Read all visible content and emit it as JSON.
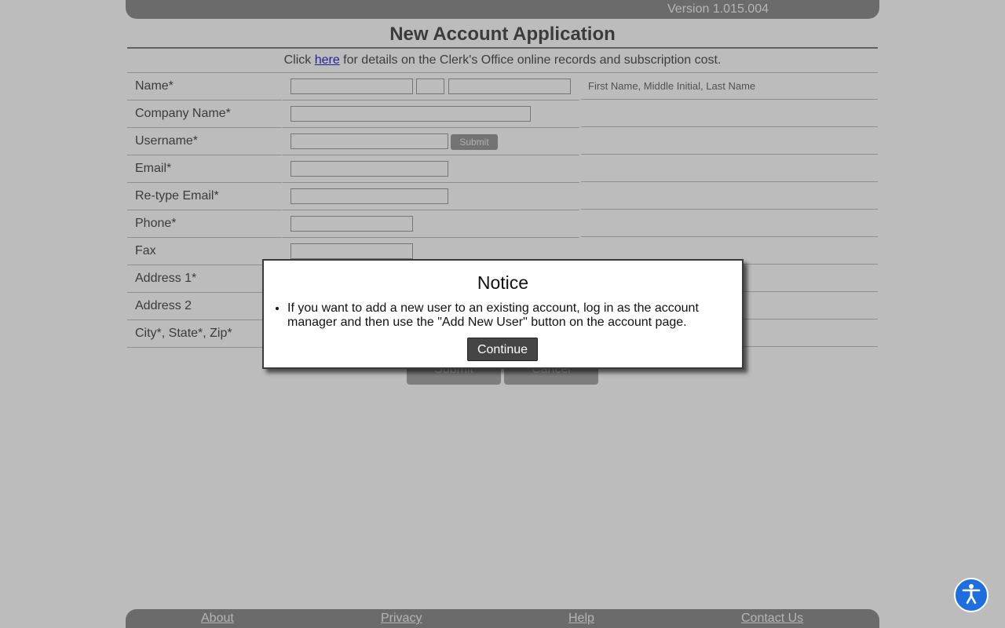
{
  "header": {
    "version": "Version 1.015.004"
  },
  "page": {
    "title": "New Account Application",
    "info": {
      "prefix": "Click ",
      "link": "here",
      "suffix": " for details on the Clerk's Office online records and subscription cost."
    }
  },
  "form": {
    "rows": [
      {
        "label": "Name*",
        "hint": "First Name, Middle Initial, Last Name"
      },
      {
        "label": "Company Name*"
      },
      {
        "label": "Username*",
        "submit_label": "Submit"
      },
      {
        "label": "Email*"
      },
      {
        "label": "Re-type Email*"
      },
      {
        "label": "Phone*"
      },
      {
        "label": "Fax"
      },
      {
        "label": "Address 1*"
      },
      {
        "label": "Address 2"
      },
      {
        "label": "City*, State*, Zip*"
      }
    ],
    "buttons": {
      "submit": "Submit",
      "cancel": "Cancel"
    }
  },
  "footer": {
    "links": [
      "About",
      "Privacy",
      "Help",
      "Contact Us"
    ]
  },
  "modal": {
    "title": "Notice",
    "items": [
      "If you want to add a new user to an existing account, log in as the account manager and then use the \"Add New User\" button on the account page."
    ],
    "continue_label": "Continue"
  },
  "icons": {
    "accessibility": "accessibility-person-icon"
  },
  "colors": {
    "accent": "#1d6fe0",
    "bar": "#7d7d7d",
    "link": "#0a00c9"
  }
}
